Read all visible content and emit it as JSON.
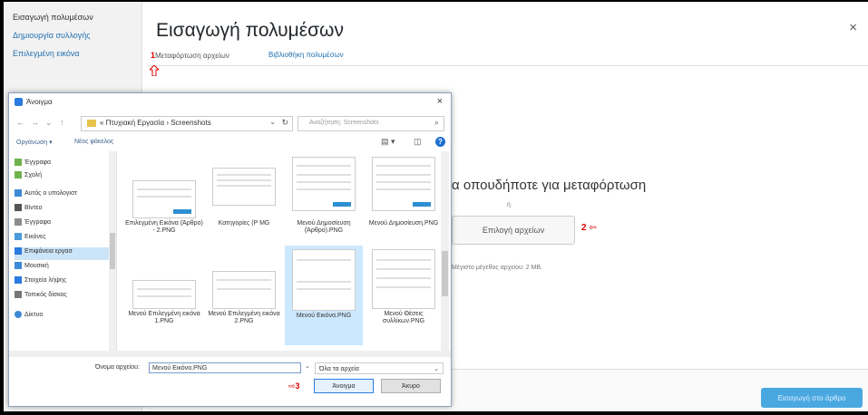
{
  "media_menu": {
    "items": [
      {
        "label": "Εισαγωγή πολυμέσων",
        "current": true
      },
      {
        "label": "Δημιουργία συλλογής",
        "current": false
      },
      {
        "label": "Επιλεγμένη εικόνα",
        "current": false
      }
    ]
  },
  "modal": {
    "title": "Εισαγωγή πολυμέσων",
    "close_label": "×",
    "tabs": [
      {
        "marker": "1",
        "label": "Μεταφόρτωση αρχείων",
        "active": true
      },
      {
        "marker": "",
        "label": "Βιβλιοθήκη πολυμέσων",
        "active": false
      }
    ]
  },
  "uploader": {
    "drop_text": "α οπουδήποτε για μεταφόρτωση",
    "or_text": "ή",
    "select_button": "Επιλογή αρχείων",
    "marker2": "2",
    "max_size": "Μέγιστο μέγεθος αρχείου: 2 MB."
  },
  "footer": {
    "insert_button": "Εισαγωγή στο άρθρο"
  },
  "dialog": {
    "title": "Άνοιγμα",
    "close_label": "×",
    "nav": {
      "back": "←",
      "forward": "→",
      "recent": "⌄",
      "up": "↑",
      "path": "« Πτυχιακή Εργασία › Screenshots",
      "search_placeholder": "Αναζήτηση: Screenshots"
    },
    "toolbar": {
      "organize": "Οργάνωση ▾",
      "new_folder": "Νέος φάκελος"
    },
    "nav_pane": [
      {
        "label": "Έγγραφα",
        "icon": "documents-icon",
        "selected": false
      },
      {
        "label": "Σχολή",
        "icon": "folder-icon",
        "selected": false
      },
      {
        "label": "Αυτός ο υπολογιστ",
        "icon": "computer-icon",
        "selected": false
      },
      {
        "label": "Βίντεο",
        "icon": "video-icon",
        "selected": false
      },
      {
        "label": "Έγγραφα",
        "icon": "documents-icon",
        "selected": false
      },
      {
        "label": "Εικόνες",
        "icon": "pictures-icon",
        "selected": false
      },
      {
        "label": "Επιφάνεια εργασ",
        "icon": "desktop-icon",
        "selected": true
      },
      {
        "label": "Μουσική",
        "icon": "music-icon",
        "selected": false
      },
      {
        "label": "Στοιχεία λήψης",
        "icon": "downloads-icon",
        "selected": false
      },
      {
        "label": "Τοπικός δίσκος",
        "icon": "drive-icon",
        "selected": false
      },
      {
        "label": "Δίκτυο",
        "icon": "network-icon",
        "selected": false
      }
    ],
    "files": [
      {
        "name": "Επιλεγμένη Εικόνα (Άρθρο) - 2.PNG",
        "selected": false
      },
      {
        "name": "Κατηγορίες (Ρ MG",
        "selected": false
      },
      {
        "name": "Μενού Δημοσίευση (Άρθρο).PNG",
        "selected": false
      },
      {
        "name": "Μενού Δημοσίευση.PNG",
        "selected": false
      },
      {
        "name": "Μενού Επιλεγμένη εικόνα 1.PNG",
        "selected": false
      },
      {
        "name": "Μενού Επιλεγμένη εικόνα 2.PNG",
        "selected": false
      },
      {
        "name": "Μενού Εικόνα.PNG",
        "selected": true
      },
      {
        "name": "Μενού Θέσεις συλλίκων.PNG",
        "selected": false
      }
    ],
    "filename_label": "Όνομα αρχείου:",
    "filename_value": "Μενού Εικόνα.PNG",
    "filetype": "Όλα τα αρχεία",
    "marker3": "3",
    "open_button": "Άνοιγμα",
    "cancel_button": "Άκυρο"
  },
  "colors": {
    "accent": "#2271b1",
    "marker_red": "#dd0000",
    "insert_blue": "#4aa8e0"
  }
}
